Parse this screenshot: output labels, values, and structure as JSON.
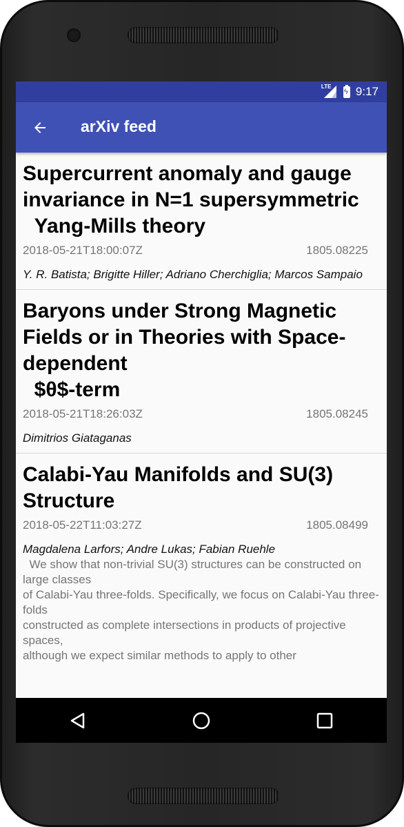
{
  "status_bar": {
    "network": "LTE",
    "time": "9:17"
  },
  "app_bar": {
    "title": "arXiv feed",
    "back_icon": "arrow-back-icon"
  },
  "entries": [
    {
      "title": "Supercurrent anomaly and gauge invariance in N=1 supersymmetric\n  Yang-Mills theory",
      "date": "2018-05-21T18:00:07Z",
      "id": "1805.08225",
      "authors": "Y. R. Batista; Brigitte Hiller; Adriano Cherchiglia; Marcos Sampaio"
    },
    {
      "title": "Baryons under Strong Magnetic Fields or in Theories with Space-dependent\n  $θ$-term",
      "date": "2018-05-21T18:26:03Z",
      "id": "1805.08245",
      "authors": "Dimitrios Giataganas"
    },
    {
      "title": "Calabi-Yau Manifolds and SU(3) Structure",
      "date": "2018-05-22T11:03:27Z",
      "id": "1805.08499",
      "authors": "Magdalena Larfors; Andre Lukas; Fabian Ruehle",
      "summary": "  We show that non-trivial SU(3) structures can be constructed on large classes\nof Calabi-Yau three-folds. Specifically, we focus on Calabi-Yau three-folds\nconstructed as complete intersections in products of projective spaces,\nalthough we expect similar methods to apply to other"
    }
  ],
  "nav_bar": {
    "back": "back-triangle-icon",
    "home": "home-circle-icon",
    "recents": "recents-square-icon"
  },
  "colors": {
    "status_bar": "#303f9f",
    "app_bar": "#3f51b5"
  }
}
